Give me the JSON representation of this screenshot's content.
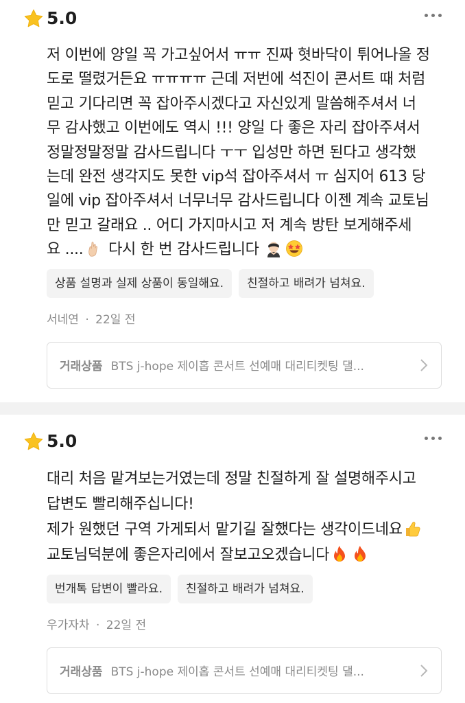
{
  "colors": {
    "star": "#f9c221",
    "tag_bg": "#f3f3f3",
    "meta": "#8a8a8a",
    "divider": "#f2f2f2"
  },
  "reviews": [
    {
      "rating": "5.0",
      "body_parts": [
        "저 이번에 양일 꼭 가고싶어서 ㅠㅠ 진짜 혓바닥이 튀어나올 정\n도로 떨렸거든요 ㅠㅠㅠㅠ 근데 저번에 석진이 콘서트 때 처럼\n믿고 기다리면 꼭 잡아주시겠다고 자신있게 말씀해주셔서 너\n무 감사했고 이번에도 역시 !!! 양일 다 좋은 자리 잡아주셔서\n정말정말정말 감사드립니다 ㅜㅜ 입성만 하면 된다고 생각했\n는데 완전 생각지도 못한 vip석 잡아주셔서 ㅠ 심지어 613 당\n일에 vip 잡아주셔서 너무너무 감사드립니다 이젠 계속 교토님\n만 믿고 갈래요 .. 어디 가지마시고 저 계속 방탄 보게해주세\n요 ....",
        " 다시 한 번 감사드립니다 "
      ],
      "emoji": [
        "pinched-fingers-icon",
        "person-bowing-icon",
        "star-struck-icon"
      ],
      "tags": [
        "상품 설명과 실제 상품이 동일해요.",
        "친절하고 배려가 넘쳐요."
      ],
      "author": "서네연",
      "time": "22일 전",
      "product_label": "거래상품",
      "product_name": "BTS j-hope 제이홉 콘서트 선예매 대리티켓팅 댈..."
    },
    {
      "rating": "5.0",
      "body_parts": [
        "대리 처음 맡겨보는거였는데 정말 친절하게 잘 설명해주시고\n답변도 빨리해주십니다!\n제가 원했던 구역 가게되서 맡기길 잘했다는 생각이드네요",
        "\n교토님덕분에 좋은자리에서 잘보고오겠습니다"
      ],
      "emoji": [
        "thumbs-up-icon",
        "fire-icon",
        "fire-icon"
      ],
      "tags": [
        "번개톡 답변이 빨라요.",
        "친절하고 배려가 넘쳐요."
      ],
      "author": "우가자차",
      "time": "22일 전",
      "product_label": "거래상품",
      "product_name": "BTS j-hope 제이홉 콘서트 선예매 대리티켓팅 댈..."
    }
  ]
}
